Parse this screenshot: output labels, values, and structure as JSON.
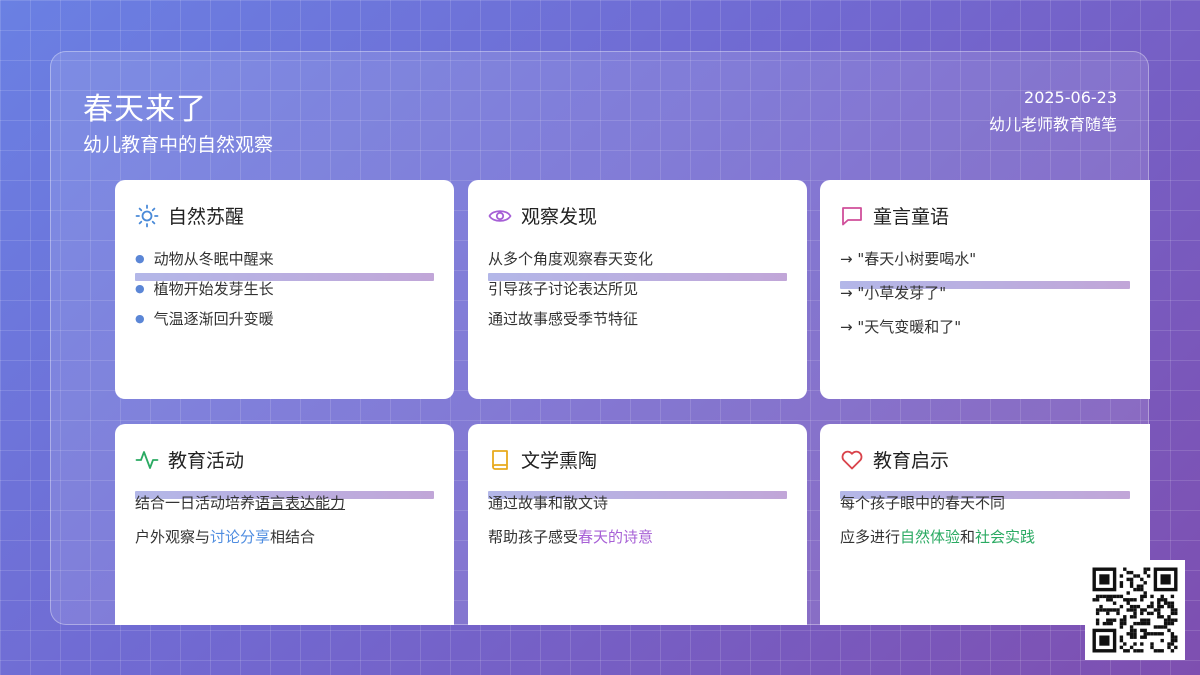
{
  "header": {
    "title": "春天来了",
    "subtitle": "幼儿教育中的自然观察",
    "date": "2025-06-23",
    "author": "幼儿老师教育随笔"
  },
  "cards": [
    {
      "title": "自然苏醒",
      "icon": "sun-icon",
      "icon_color": "#4a8ad8",
      "items": [
        "动物从冬眠中醒来",
        "植物开始发芽生长",
        "气温逐渐回升变暖"
      ]
    },
    {
      "title": "观察发现",
      "icon": "eye-icon",
      "icon_color": "#a65fd6",
      "items": [
        "从多个角度观察春天变化",
        "引导孩子讨论表达所见",
        "通过故事感受季节特征"
      ]
    },
    {
      "title": "童言童语",
      "icon": "message-square-icon",
      "icon_color": "#d04f9a",
      "items": [
        "→ \"春天小树要喝水\"",
        "→ \"小草发芽了\"",
        "→ \"天气变暖和了\""
      ]
    },
    {
      "title": "教育活动",
      "icon": "activity-icon",
      "icon_color": "#2aaa62",
      "items": [
        {
          "pre": "结合一日活动培养",
          "em": "语言表达能力",
          "post": ""
        },
        {
          "pre": "户外观察与",
          "em": "讨论分享",
          "post": "相结合"
        }
      ]
    },
    {
      "title": "文学熏陶",
      "icon": "book-icon",
      "icon_color": "#e8a91c",
      "items": [
        {
          "pre": "通过故事和散文诗",
          "em": "",
          "post": ""
        },
        {
          "pre": "帮助孩子感受",
          "em": "春天的诗意",
          "post": ""
        }
      ]
    },
    {
      "title": "教育启示",
      "icon": "heart-icon",
      "icon_color": "#d9434b",
      "items": [
        {
          "pre": "每个孩子眼中的春天不同",
          "em": "",
          "post": ""
        },
        {
          "pre": "应多进行",
          "em": "自然体验",
          "mid": "和",
          "em2": "社会实践"
        }
      ]
    }
  ],
  "qr_code": {
    "icon": "qr-code-icon"
  }
}
